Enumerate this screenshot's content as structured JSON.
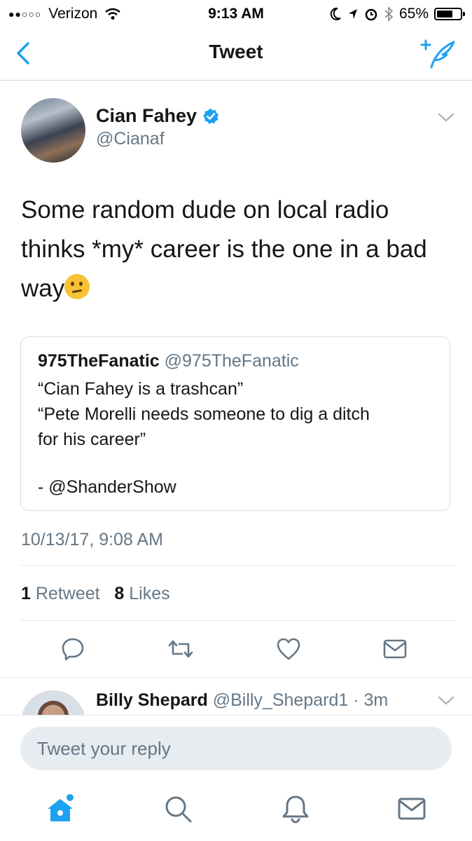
{
  "status_bar": {
    "carrier": "Verizon",
    "time": "9:13 AM",
    "battery": "65%",
    "battery_level": 0.65
  },
  "nav": {
    "title": "Tweet",
    "back_icon": "chevron-left-icon",
    "compose_icon": "compose-tweet-icon"
  },
  "tweet": {
    "author_name": "Cian Fahey",
    "author_handle": "@Cianaf",
    "verified": true,
    "text": "Some random dude on local radio thinks *my* career is the one in a bad way",
    "emoji": "thinking-face-icon",
    "quote": {
      "name": "975TheFanatic",
      "handle": "@975TheFanatic",
      "line1": "“Cian Fahey is a trashcan”",
      "line2": "“Pete Morelli needs someone to dig a ditch",
      "line3": "for his career”",
      "line4": "- @ShanderShow"
    },
    "timestamp": "10/13/17, 9:08 AM",
    "retweet_count": "1",
    "retweet_label": "Retweet",
    "like_count": "8",
    "like_label": "Likes"
  },
  "reply_preview": {
    "name": "Billy Shepard",
    "handle": "@Billy_Shepard1",
    "age": "· 3m"
  },
  "composer": {
    "placeholder": "Tweet your reply"
  },
  "colors": {
    "accent": "#1da1f2",
    "secondary_text": "#657786",
    "divider": "#e1e8ed"
  }
}
